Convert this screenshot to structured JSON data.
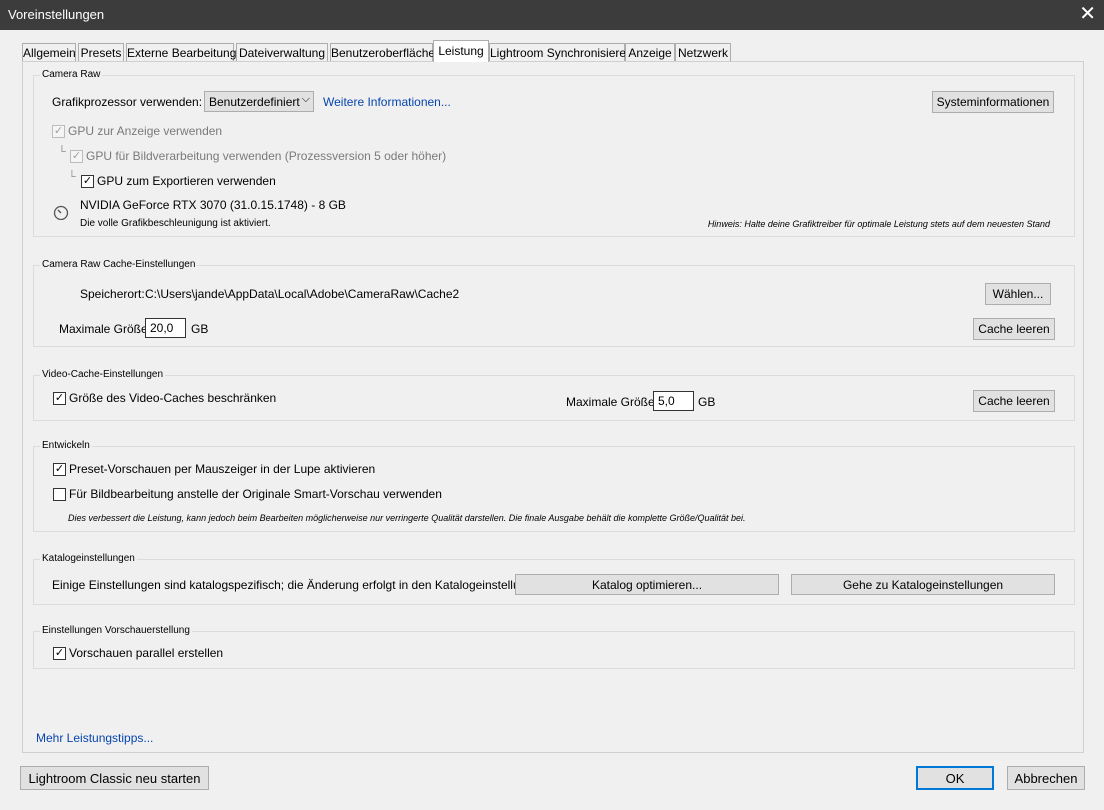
{
  "window": {
    "title": "Voreinstellungen",
    "close_glyph": "✕"
  },
  "tabs": [
    {
      "label": "Allgemein"
    },
    {
      "label": "Presets"
    },
    {
      "label": "Externe Bearbeitung"
    },
    {
      "label": "Dateiverwaltung"
    },
    {
      "label": "Benutzeroberfläche"
    },
    {
      "label": "Leistung",
      "active": true
    },
    {
      "label": "Lightroom Synchronisieren"
    },
    {
      "label": "Anzeige"
    },
    {
      "label": "Netzwerk"
    }
  ],
  "camera_raw": {
    "legend": "Camera Raw",
    "gpu_label": "Grafikprozessor verwenden:",
    "gpu_select_value": "Benutzerdefiniert",
    "more_info_link": "Weitere Informationen...",
    "sysinfo_button": "Systeminformationen",
    "gpu_display_label": "GPU zur Anzeige verwenden",
    "gpu_display_checked": true,
    "gpu_image_label": "GPU für Bildverarbeitung verwenden (Prozessversion 5 oder höher)",
    "gpu_image_checked": true,
    "gpu_export_label": "GPU zum Exportieren verwenden",
    "gpu_export_checked": true,
    "gpu_name": "NVIDIA GeForce RTX 3070 (31.0.15.1748) - 8 GB",
    "gpu_status": "Die volle Grafikbeschleunigung ist aktiviert.",
    "hint": "Hinweis: Halte deine Grafiktreiber für optimale Leistung stets auf dem neuesten Stand",
    "icon": "gauge-icon"
  },
  "cache": {
    "legend": "Camera Raw Cache-Einstellungen",
    "location_label": "Speicherort:",
    "location_value": "C:\\Users\\jande\\AppData\\Local\\Adobe\\CameraRaw\\Cache2",
    "choose_button": "Wählen...",
    "max_size_label": "Maximale Größe:",
    "max_size_value": "20,0",
    "unit": "GB",
    "clear_button": "Cache leeren"
  },
  "video_cache": {
    "legend": "Video-Cache-Einstellungen",
    "limit_label": "Größe des Video-Caches beschränken",
    "limit_checked": true,
    "max_size_label": "Maximale Größe:",
    "max_size_value": "5,0",
    "unit": "GB",
    "clear_button": "Cache leeren"
  },
  "develop": {
    "legend": "Entwickeln",
    "preset_preview_label": "Preset-Vorschauen per Mauszeiger in der Lupe aktivieren",
    "preset_preview_checked": true,
    "smart_preview_label": "Für Bildbearbeitung anstelle der Originale Smart-Vorschau verwenden",
    "smart_preview_checked": false,
    "note": "Dies verbessert die Leistung, kann jedoch beim Bearbeiten möglicherweise nur verringerte Qualität darstellen. Die finale Ausgabe behält die komplette Größe/Qualität bei."
  },
  "catalog": {
    "legend": "Katalogeinstellungen",
    "text": "Einige Einstellungen sind katalogspezifisch; die Änderung erfolgt in den Katalogeinstellungen.",
    "optimize_button": "Katalog optimieren...",
    "goto_button": "Gehe zu Katalogeinstellungen"
  },
  "preview": {
    "legend": "Einstellungen Vorschauerstellung",
    "parallel_label": "Vorschauen parallel erstellen",
    "parallel_checked": true
  },
  "footer": {
    "tips_link": "Mehr Leistungstipps...",
    "restart_button": "Lightroom Classic neu starten",
    "ok_button": "OK",
    "cancel_button": "Abbrechen"
  },
  "colors": {
    "titlebar": "#3c3c3c",
    "link": "#0645ad",
    "accent": "#0078d7",
    "background": "#f0f0f0"
  }
}
